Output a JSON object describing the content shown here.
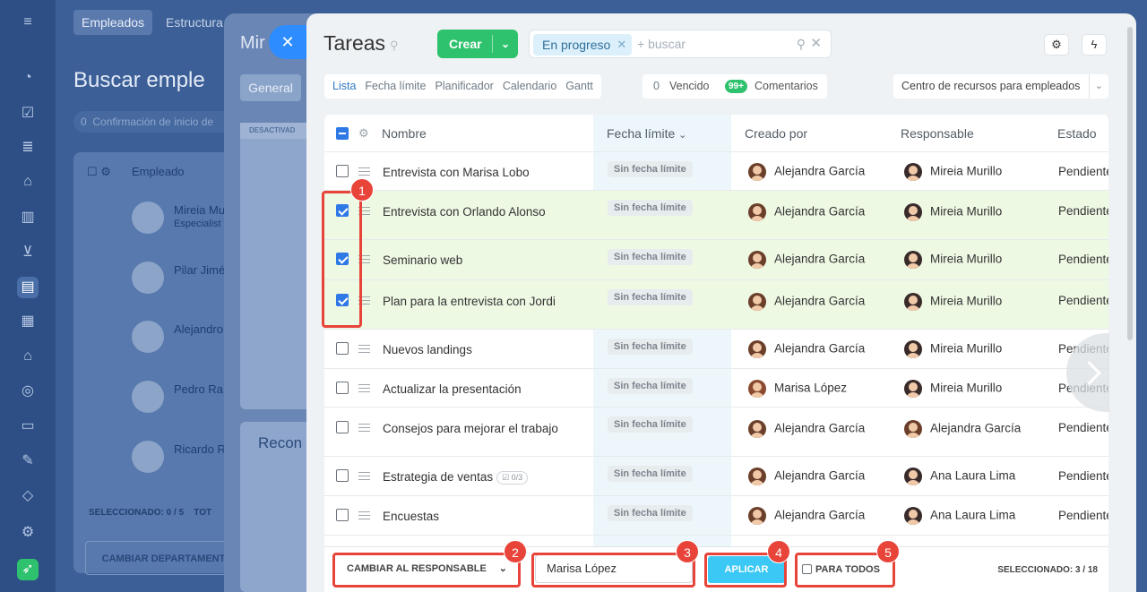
{
  "background_app": {
    "tabs": [
      "Empleados",
      "Estructura"
    ],
    "title": "Buscar emple",
    "confirm_pill": "Confirmación de inicio de",
    "confirm_count": "0",
    "table_header": "Empleado",
    "employees": [
      {
        "name": "Mireia Mu",
        "role": "Especialist"
      },
      {
        "name": "Pilar Jimé",
        "role": ""
      },
      {
        "name": "Alejandro",
        "role": ""
      },
      {
        "name": "Pedro Ra",
        "role": ""
      },
      {
        "name": "Ricardo R",
        "role": ""
      }
    ],
    "selected_label": "SELECCIONADO: 0 / 5",
    "total_label": "TOT",
    "change_dept_button": "CAMBIAR DEPARTAMENT"
  },
  "middle_panel": {
    "title": "Mir",
    "tab": "General",
    "tag": "DESACTIVAD",
    "card_title": "Recon"
  },
  "panel": {
    "title": "Tareas",
    "create_button": "Crear",
    "search": {
      "chip": "En progreso",
      "placeholder": "+ buscar"
    },
    "view_tabs": [
      "Lista",
      "Fecha límite",
      "Planificador",
      "Calendario",
      "Gantt"
    ],
    "counters": {
      "overdue_count": "0",
      "overdue_label": "Vencido",
      "comments_badge": "99+",
      "comments_label": "Comentarios"
    },
    "resource_center": "Centro de recursos para empleados",
    "columns": {
      "name": "Nombre",
      "deadline": "Fecha límite",
      "created_by": "Creado por",
      "responsible": "Responsable",
      "status": "Estado"
    },
    "rows": [
      {
        "name": "Entrevista con Marisa Lobo",
        "checklist": "",
        "deadline": "Sin fecha límite",
        "creator": "Alejandra García",
        "responsible": "Mireia Murillo",
        "status": "Pendiente",
        "selected": false
      },
      {
        "name": "Entrevista con Orlando Alonso",
        "checklist": "",
        "deadline": "Sin fecha límite",
        "creator": "Alejandra García",
        "responsible": "Mireia Murillo",
        "status": "Pendiente",
        "selected": true
      },
      {
        "name": "Seminario web",
        "checklist": "",
        "deadline": "Sin fecha límite",
        "creator": "Alejandra García",
        "responsible": "Mireia Murillo",
        "status": "Pendiente",
        "selected": true
      },
      {
        "name": "Plan para la entrevista con Jordi",
        "checklist": "",
        "deadline": "Sin fecha límite",
        "creator": "Alejandra García",
        "responsible": "Mireia Murillo",
        "status": "Pendiente",
        "selected": true
      },
      {
        "name": "Nuevos landings",
        "checklist": "",
        "deadline": "Sin fecha límite",
        "creator": "Alejandra García",
        "responsible": "Mireia Murillo",
        "status": "Pendiente",
        "selected": false
      },
      {
        "name": "Actualizar la presentación",
        "checklist": "",
        "deadline": "Sin fecha límite",
        "creator": "Marisa López",
        "responsible": "Mireia Murillo",
        "status": "Pendiente",
        "selected": false
      },
      {
        "name": "Consejos para mejorar el trabajo",
        "checklist": "",
        "deadline": "Sin fecha límite",
        "creator": "Alejandra García",
        "responsible": "Alejandra García",
        "status": "Pendiente",
        "selected": false
      },
      {
        "name": "Estrategia de ventas",
        "checklist": "0/3",
        "deadline": "Sin fecha límite",
        "creator": "Alejandra García",
        "responsible": "Ana Laura Lima",
        "status": "Pendiente",
        "selected": false
      },
      {
        "name": "Encuestas",
        "checklist": "",
        "deadline": "Sin fecha límite",
        "creator": "Alejandra García",
        "responsible": "Ana Laura Lima",
        "status": "Pendiente",
        "selected": false
      }
    ],
    "bottom_bar": {
      "action_select": "CAMBIAR AL RESPONSABLE",
      "responsible_value": "Marisa López",
      "apply_button": "APLICAR",
      "for_all_label": "PARA TODOS",
      "selected_label": "SELECCIONADO: 3 / 18"
    }
  },
  "annotations": [
    "1",
    "2",
    "3",
    "4",
    "5"
  ],
  "colors": {
    "accent_green": "#2fc26e",
    "accent_blue": "#2e79e6",
    "apply_blue": "#3bc8f5",
    "annotation_red": "#e8443a",
    "selected_row": "#eef9e4"
  }
}
